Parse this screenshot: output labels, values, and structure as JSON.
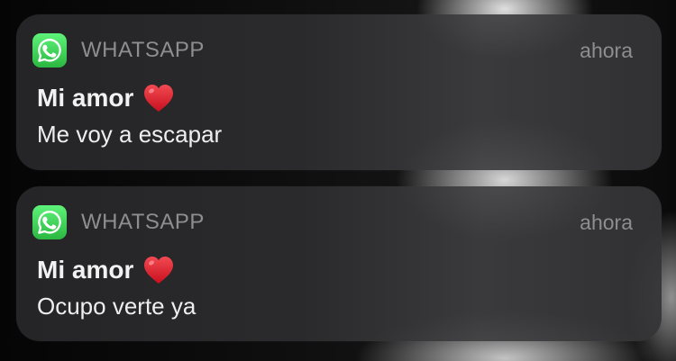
{
  "notifications": [
    {
      "app_name": "WHATSAPP",
      "time": "ahora",
      "title": "Mi amor",
      "title_emoji": "red-heart-icon",
      "message": "Me voy a escapar"
    },
    {
      "app_name": "WHATSAPP",
      "time": "ahora",
      "title": "Mi amor",
      "title_emoji": "red-heart-icon",
      "message": "Ocupo verte ya"
    }
  ],
  "colors": {
    "whatsapp_green": "#34c759",
    "heart_red": "#e0202e",
    "secondary_text": "#8e8e92"
  }
}
